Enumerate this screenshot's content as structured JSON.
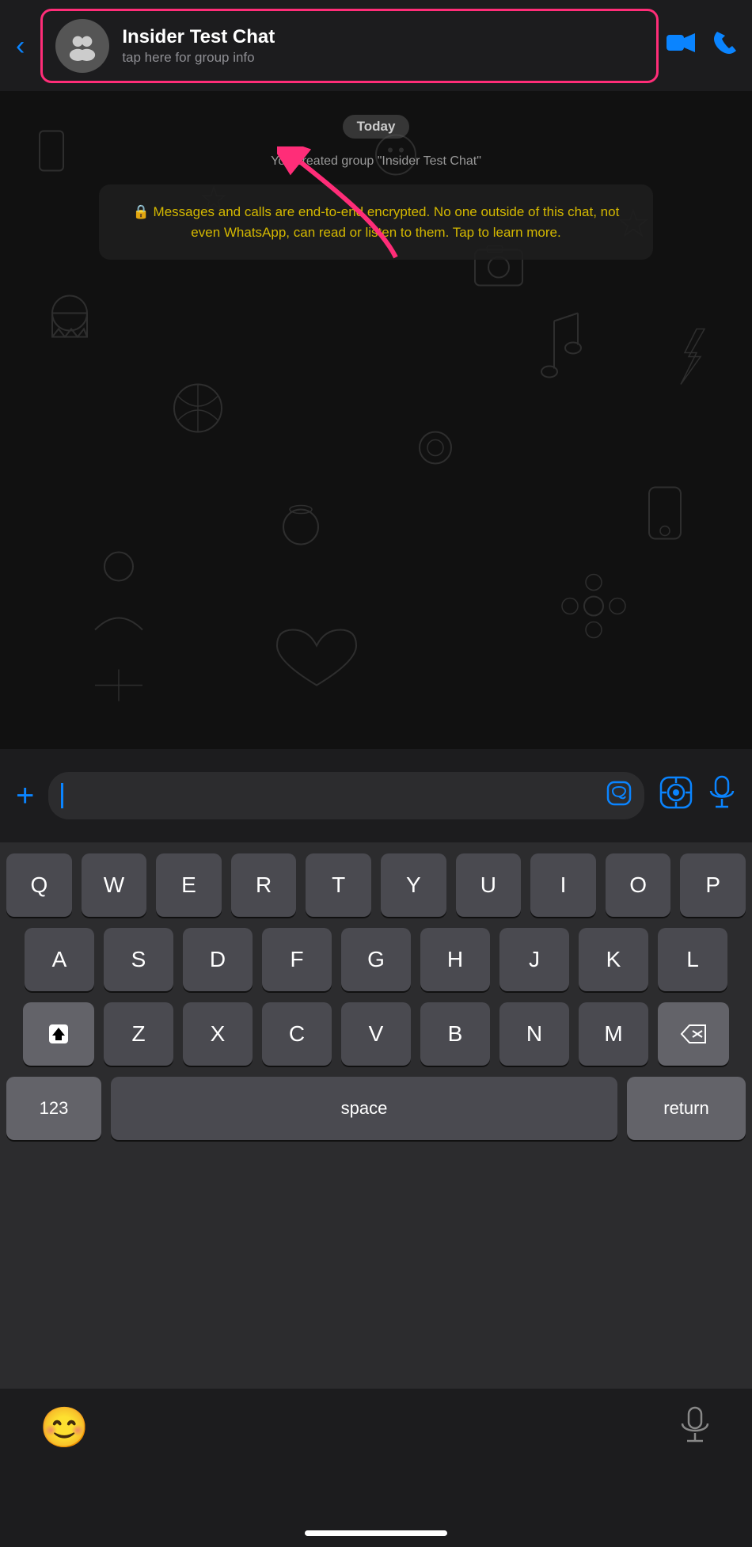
{
  "header": {
    "back_label": "‹",
    "group_name": "Insider Test Chat",
    "group_subtitle": "tap here for group info",
    "video_call_icon": "📹",
    "phone_icon": "📞"
  },
  "chat": {
    "date_label": "Today",
    "system_message": "You created group \"Insider Test Chat\"",
    "encryption_notice": "🔒 Messages and calls are end-to-end encrypted. No one outside of this chat, not even WhatsApp, can read or listen to them. Tap to learn more."
  },
  "input": {
    "plus_label": "+",
    "placeholder": "",
    "sticker_label": "🩹",
    "camera_scan_label": "⊙",
    "mic_label": "🎤"
  },
  "keyboard": {
    "rows": [
      [
        "Q",
        "W",
        "E",
        "R",
        "T",
        "Y",
        "U",
        "I",
        "O",
        "P"
      ],
      [
        "A",
        "S",
        "D",
        "F",
        "G",
        "H",
        "J",
        "K",
        "L"
      ],
      [
        "Z",
        "X",
        "C",
        "V",
        "B",
        "N",
        "M"
      ]
    ],
    "special_keys": {
      "shift": "⬆",
      "delete": "⌫",
      "numbers": "123",
      "space": "space",
      "return": "return"
    }
  },
  "bottom_bar": {
    "emoji_label": "😊",
    "mic_label": "🎤"
  }
}
